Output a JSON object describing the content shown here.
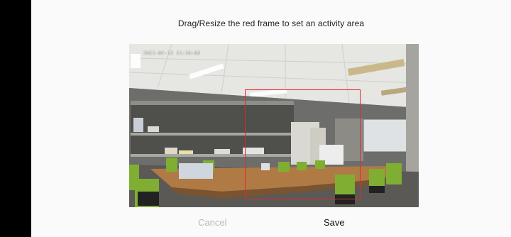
{
  "instruction": "Drag/Resize the red frame to set an activity area",
  "camera": {
    "timestamp": "2021-04-12 21:16:03",
    "frame_color": "#e02a2a"
  },
  "actions": {
    "cancel_label": "Cancel",
    "save_label": "Save"
  }
}
